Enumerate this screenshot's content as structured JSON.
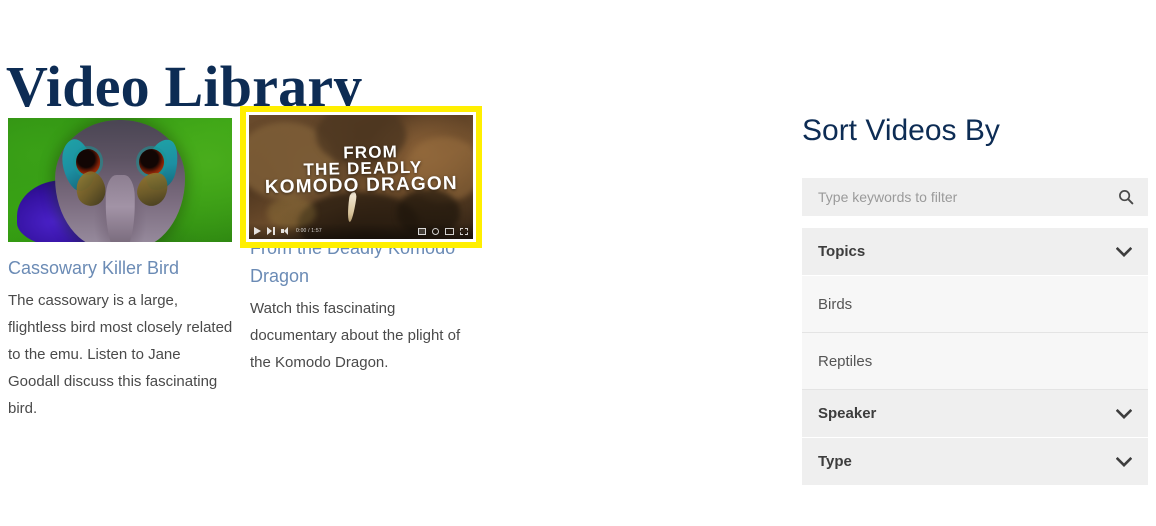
{
  "page": {
    "title": "Video Library"
  },
  "videos": [
    {
      "id": "cassowary",
      "title": "Cassowary Killer Bird",
      "description": "The cassowary is a large, flightless bird most closely related to the emu. Listen to Jane Goodall discuss this fascinating bird.",
      "thumbnail_alt": "Close-up of a cassowary head with blue neck on green background",
      "focused": false
    },
    {
      "id": "komodo",
      "title": "From the Deadly Komodo Dragon",
      "description": "Watch this fascinating documentary about the plight of the Komodo Dragon.",
      "thumbnail_alt": "Komodo dragon close-up with title overlay",
      "focused": true,
      "overlay": {
        "line1": "FROM",
        "line2": "THE DEADLY",
        "line3": "KOMODO DRAGON"
      },
      "player": {
        "play_icon": "play-icon",
        "next_icon": "next-track-icon",
        "volume_icon": "volume-icon",
        "time": "0:00 / 1:57",
        "subtitles_icon": "subtitles-icon",
        "settings_icon": "settings-gear-icon",
        "theater_icon": "theater-mode-icon",
        "fullscreen_icon": "fullscreen-icon"
      }
    }
  ],
  "sidebar": {
    "title": "Sort Videos By",
    "search": {
      "placeholder": "Type keywords to filter",
      "value": "",
      "icon": "search-icon"
    },
    "accordion": [
      {
        "label": "Topics",
        "expanded": true,
        "chevron": "chevron-down-icon",
        "items": [
          "Birds",
          "Reptiles"
        ]
      },
      {
        "label": "Speaker",
        "expanded": false,
        "chevron": "chevron-down-icon",
        "items": []
      },
      {
        "label": "Type",
        "expanded": false,
        "chevron": "chevron-down-icon",
        "items": []
      }
    ]
  },
  "colors": {
    "heading": "#0d2c54",
    "link": "#6b8bb5",
    "body_text": "#4a4a4a",
    "focus_ring": "#ffef00",
    "panel_header_bg": "#efefef",
    "panel_item_bg": "#f7f7f7"
  }
}
